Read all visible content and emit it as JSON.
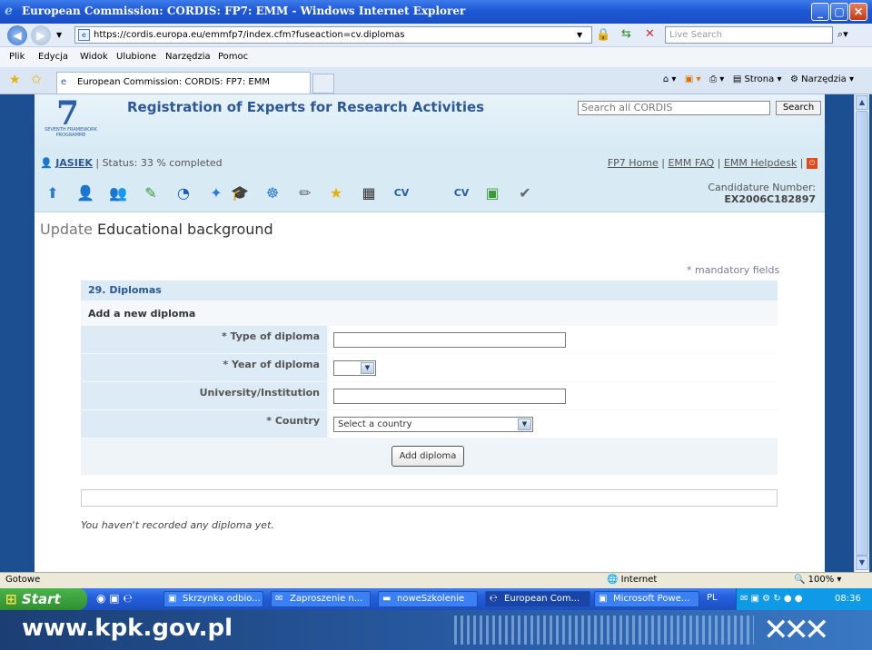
{
  "browser": {
    "title": "European Commission: CORDIS: FP7: EMM - Windows Internet Explorer",
    "url": "https://cordis.europa.eu/emmfp7/index.cfm?fuseaction=cv.diplomas",
    "live_search_placeholder": "Live Search",
    "menu": [
      "Plik",
      "Edycja",
      "Widok",
      "Ulubione",
      "Narzędzia",
      "Pomoc"
    ],
    "tab_title": "European Commission: CORDIS: FP7: EMM",
    "tools": {
      "strona": "Strona",
      "narzedzia": "Narzędzia"
    },
    "status_text": "Gotowe",
    "zone": "Internet",
    "zoom": "100%"
  },
  "site": {
    "title": "Registration of Experts for Research Activities",
    "search_placeholder": "Search all CORDIS",
    "search_button": "Search",
    "logo_text": "SEVENTH FRAMEWORK PROGRAMME",
    "user": "JASIEK",
    "status": "| Status: 33 % completed",
    "links": [
      "FP7 Home",
      "EMM FAQ",
      "EMM Helpdesk"
    ],
    "candidature_label": "Candidature Number:",
    "candidature_number": "EX2006C182897"
  },
  "page": {
    "title_prefix": "Update",
    "title": "Educational background",
    "mandatory": "* mandatory fields",
    "section": "29. Diplomas",
    "subsection": "Add a new diploma",
    "fields": [
      {
        "label": "* Type of diploma",
        "type": "text",
        "value": ""
      },
      {
        "label": "* Year of diploma",
        "type": "select",
        "value": ""
      },
      {
        "label": "University/Institution",
        "type": "text",
        "value": ""
      },
      {
        "label": "* Country",
        "type": "select",
        "value": "Select a country"
      }
    ],
    "add_button": "Add diploma",
    "empty_message": "You haven't recorded any diploma yet."
  },
  "taskbar": {
    "start": "Start",
    "items": [
      "Skrzynka odbio...",
      "Zaproszenie n...",
      "noweSzkolenie",
      "European Com...",
      "Microsoft Powe..."
    ],
    "lang": "PL",
    "time": "08:36"
  },
  "footer": {
    "url": "www.kpk.gov.pl"
  },
  "colors": {
    "accent": "#2d5797",
    "header_bg": "#d8ebf4",
    "frame": "#1b4f91"
  }
}
